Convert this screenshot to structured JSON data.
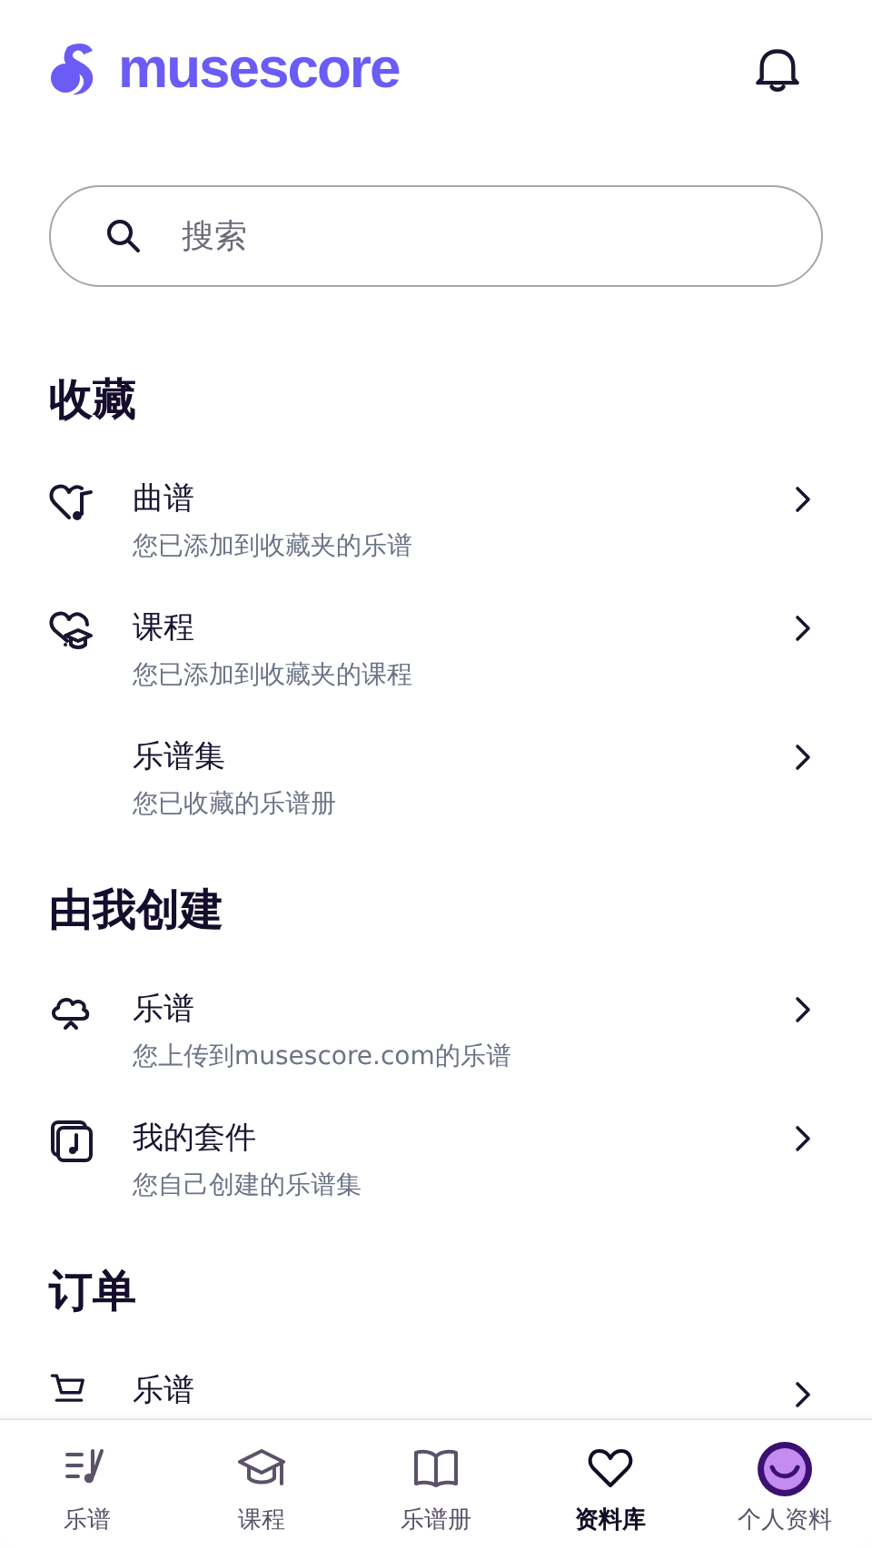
{
  "header": {
    "logo_text": "musescore"
  },
  "search": {
    "placeholder": "搜索"
  },
  "sections": [
    {
      "title": "收藏",
      "items": [
        {
          "kind": "heart-note",
          "title": "曲谱",
          "subtitle": "您已添加到收藏夹的乐谱"
        },
        {
          "kind": "heart-cap",
          "title": "课程",
          "subtitle": "您已添加到收藏夹的课程"
        },
        {
          "kind": "plain",
          "title": "乐谱集",
          "subtitle": "您已收藏的乐谱册"
        }
      ]
    },
    {
      "title": "由我创建",
      "items": [
        {
          "kind": "cloud",
          "title": "乐谱",
          "subtitle": "您上传到musescore.com的乐谱"
        },
        {
          "kind": "album",
          "title": "我的套件",
          "subtitle": "您自己创建的乐谱集"
        }
      ]
    },
    {
      "title": "订单",
      "items": [
        {
          "kind": "cart",
          "title": "乐谱"
        }
      ]
    }
  ],
  "nav": [
    {
      "kind": "scores",
      "label": "乐谱",
      "selected": false
    },
    {
      "kind": "cap",
      "label": "课程",
      "selected": false
    },
    {
      "kind": "book",
      "label": "乐谱册",
      "selected": false
    },
    {
      "kind": "heart",
      "label": "资料库",
      "selected": true
    },
    {
      "kind": "avatar",
      "label": "个人资料",
      "selected": false
    }
  ]
}
